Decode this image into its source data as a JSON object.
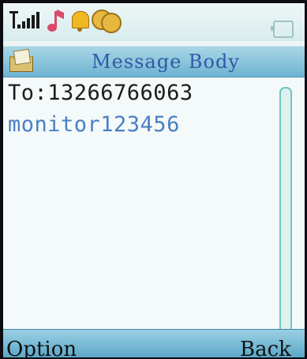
{
  "status_bar": {
    "icons": [
      "signal-icon",
      "music-note-icon",
      "alarm-bell-icon",
      "coins-icon",
      "battery-icon"
    ]
  },
  "title_bar": {
    "icon": "message-icon",
    "title": "Message Body"
  },
  "message": {
    "to_line": "To:13266766063",
    "body": "monitor123456"
  },
  "softkeys": {
    "left": "Option",
    "right": "Back"
  },
  "colors": {
    "title_bar_bg": "#7fbfd8",
    "title_text": "#2f5aa6",
    "body_text": "#4a7fc4",
    "to_text": "#1d1d1d",
    "scrollbar": "#6fc6c0"
  }
}
